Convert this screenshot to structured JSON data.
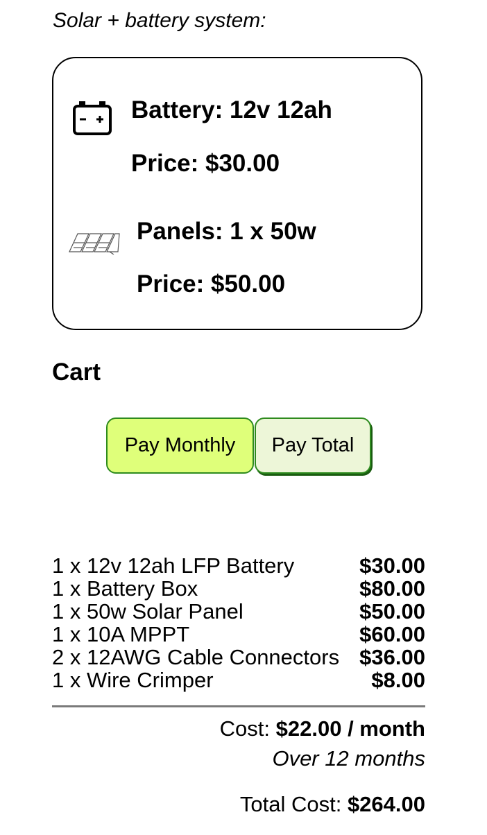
{
  "header": {
    "title": "Solar + battery system:"
  },
  "system": {
    "battery": {
      "icon": "battery-icon",
      "spec": "Battery: 12v 12ah",
      "price": "Price: $30.00"
    },
    "panels": {
      "icon": "solar-panel-icon",
      "spec": "Panels: 1 x 50w",
      "price": "Price: $50.00"
    }
  },
  "cart": {
    "title": "Cart",
    "buttons": {
      "monthly": "Pay Monthly",
      "total": "Pay Total"
    },
    "selected_payment": "monthly",
    "items": [
      {
        "label": "1 x 12v 12ah LFP Battery",
        "price": "$30.00"
      },
      {
        "label": "1 x Battery Box",
        "price": "$80.00"
      },
      {
        "label": "1 x 50w Solar Panel",
        "price": "$50.00"
      },
      {
        "label": "1 x 10A MPPT",
        "price": "$60.00"
      },
      {
        "label": "2 x 12AWG Cable Connectors",
        "price": "$36.00"
      },
      {
        "label": "1 x Wire Crimper",
        "price": "$8.00"
      }
    ],
    "cost_label": "Cost:",
    "cost_value": "$22.00 / month",
    "duration": "Over 12 months",
    "total_label": "Total Cost:",
    "total_value": "$264.00"
  },
  "colors": {
    "monthly_button_bg": "#dfff7a",
    "total_button_bg": "#edf6d8",
    "button_border": "#2e8b1e",
    "divider": "#7a7a7a"
  }
}
